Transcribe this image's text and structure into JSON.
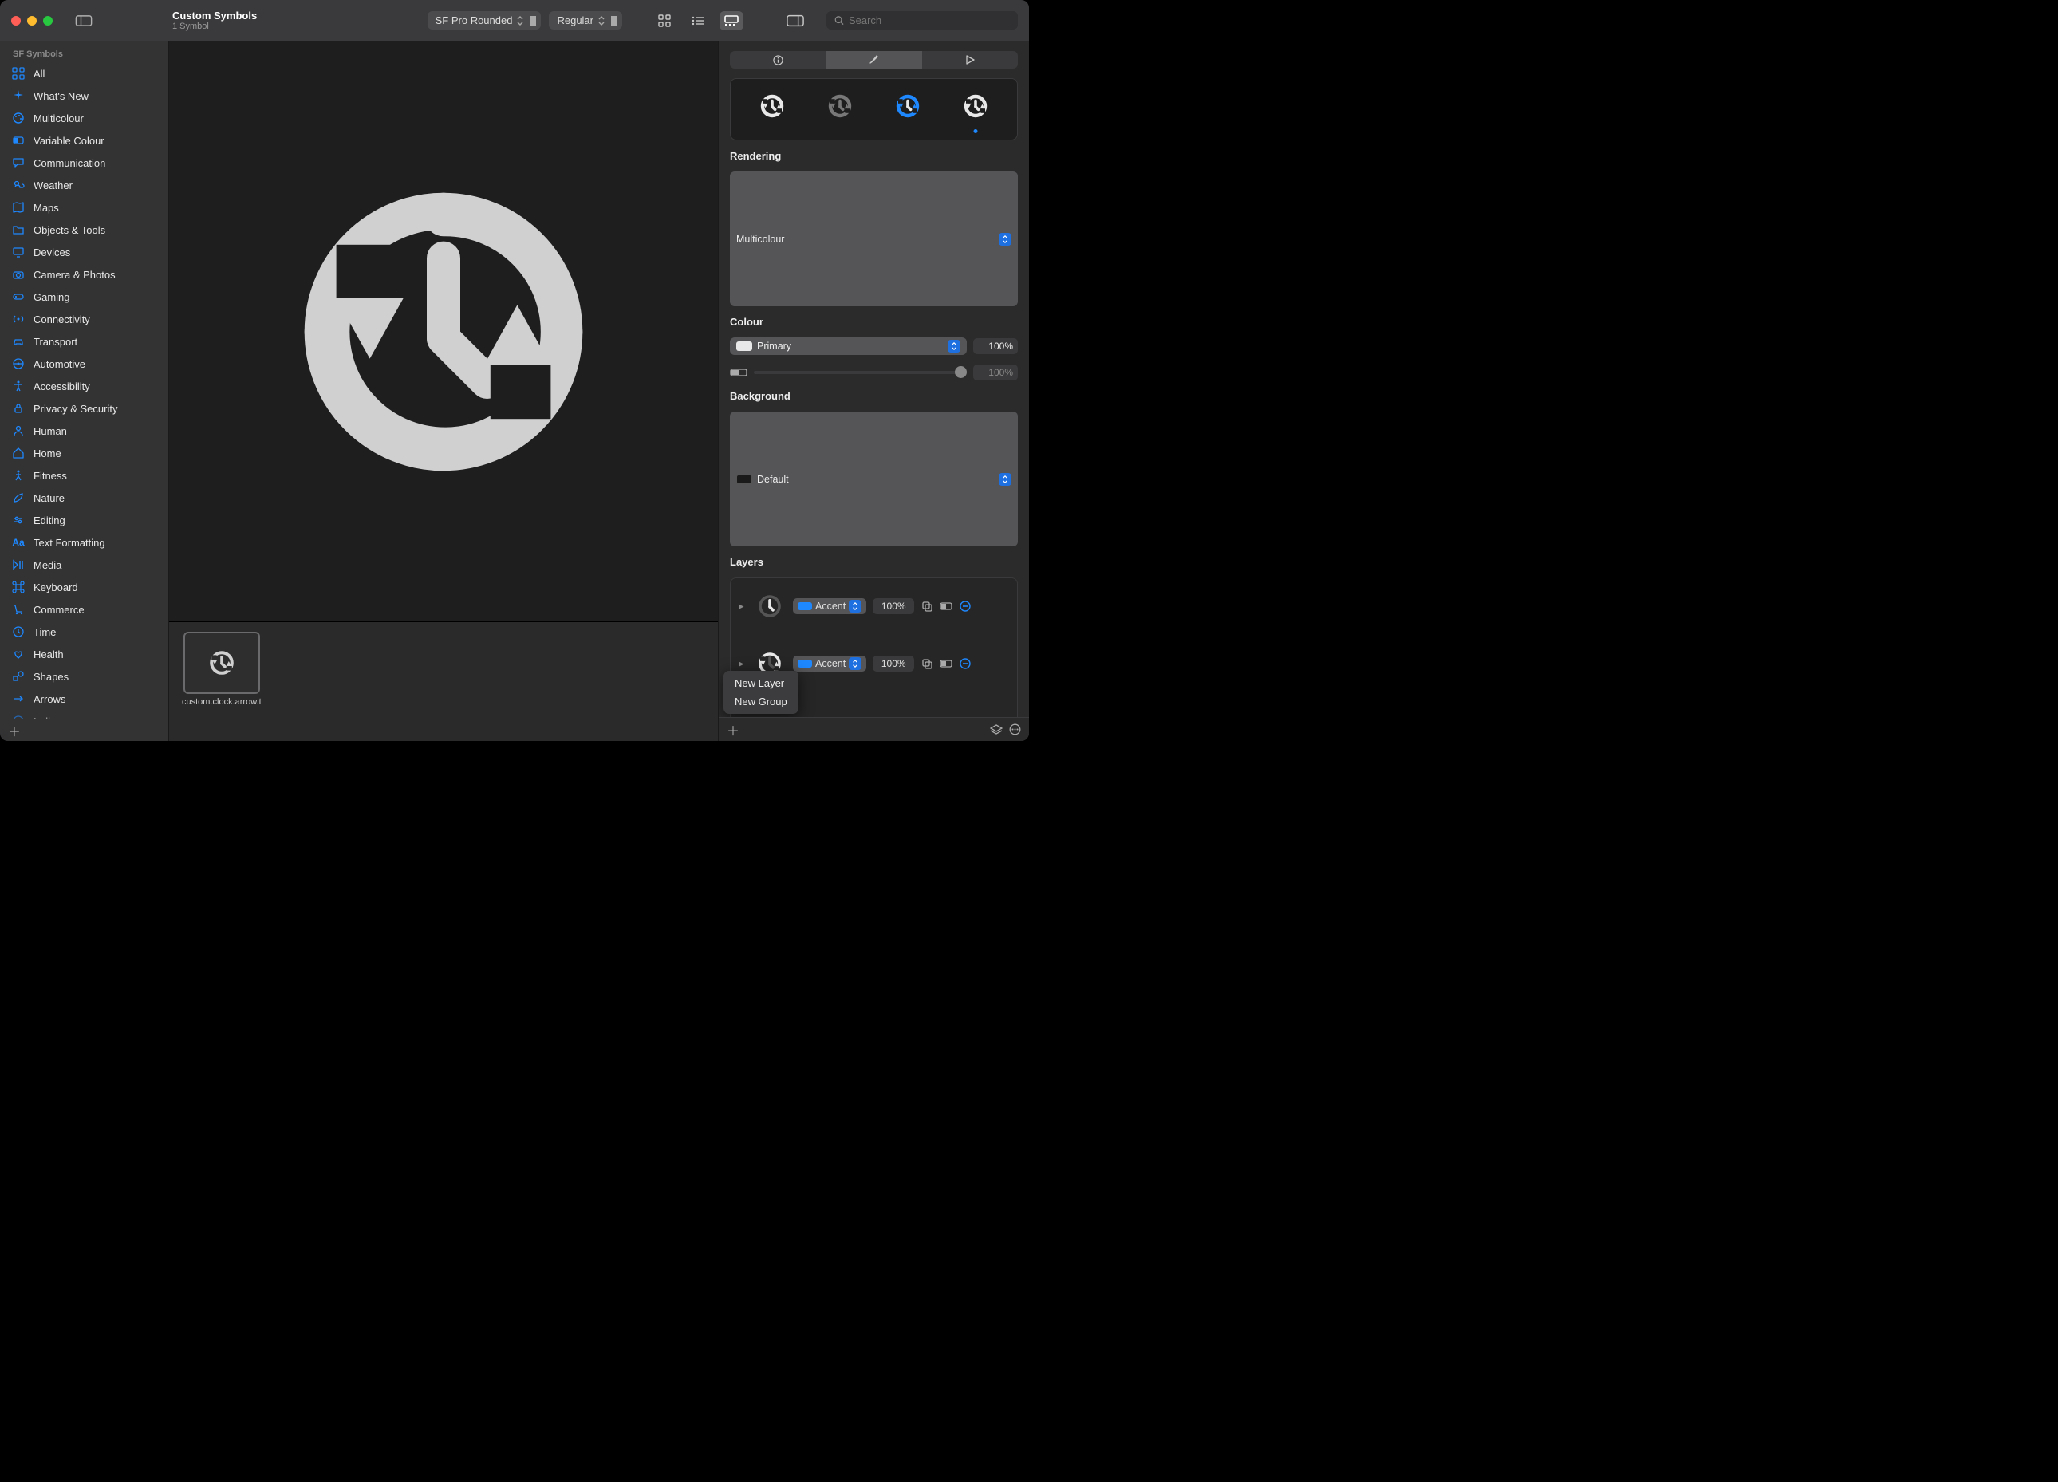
{
  "window": {
    "title": "Custom Symbols",
    "subtitle": "1 Symbol"
  },
  "toolbar": {
    "font_family": "SF Pro Rounded",
    "font_weight": "Regular",
    "search_placeholder": "Search"
  },
  "sidebar": {
    "header": "SF Symbols",
    "items": [
      {
        "label": "All",
        "icon": "grid"
      },
      {
        "label": "What's New",
        "icon": "sparkles"
      },
      {
        "label": "Multicolour",
        "icon": "paint"
      },
      {
        "label": "Variable Colour",
        "icon": "slider"
      },
      {
        "label": "Communication",
        "icon": "bubble"
      },
      {
        "label": "Weather",
        "icon": "cloudsun"
      },
      {
        "label": "Maps",
        "icon": "map"
      },
      {
        "label": "Objects & Tools",
        "icon": "folder"
      },
      {
        "label": "Devices",
        "icon": "desktop"
      },
      {
        "label": "Camera & Photos",
        "icon": "camera"
      },
      {
        "label": "Gaming",
        "icon": "gamepad"
      },
      {
        "label": "Connectivity",
        "icon": "antenna"
      },
      {
        "label": "Transport",
        "icon": "car"
      },
      {
        "label": "Automotive",
        "icon": "steering"
      },
      {
        "label": "Accessibility",
        "icon": "accessibility"
      },
      {
        "label": "Privacy & Security",
        "icon": "lock"
      },
      {
        "label": "Human",
        "icon": "person"
      },
      {
        "label": "Home",
        "icon": "home"
      },
      {
        "label": "Fitness",
        "icon": "figure"
      },
      {
        "label": "Nature",
        "icon": "leaf"
      },
      {
        "label": "Editing",
        "icon": "pencil"
      },
      {
        "label": "Text Formatting",
        "icon": "aa"
      },
      {
        "label": "Media",
        "icon": "playpause"
      },
      {
        "label": "Keyboard",
        "icon": "command"
      },
      {
        "label": "Commerce",
        "icon": "cart"
      },
      {
        "label": "Time",
        "icon": "clock"
      },
      {
        "label": "Health",
        "icon": "heart"
      },
      {
        "label": "Shapes",
        "icon": "shapes"
      },
      {
        "label": "Arrows",
        "icon": "arrows"
      },
      {
        "label": "Indices",
        "icon": "indices"
      }
    ]
  },
  "thumbnail": {
    "label": "custom.clock.arrow.triangleh…"
  },
  "inspector": {
    "rendering_label": "Rendering",
    "rendering_value": "Multicolour",
    "colour_label": "Colour",
    "colour_value": "Primary",
    "colour_opacity": "100%",
    "secondary_opacity": "100%",
    "background_label": "Background",
    "background_value": "Default",
    "layers_label": "Layers",
    "layers": [
      {
        "type": "Accent",
        "opacity": "100%"
      },
      {
        "type": "Accent",
        "opacity": "100%"
      }
    ],
    "context_menu": {
      "item1": "New Layer",
      "item2": "New Group"
    }
  }
}
